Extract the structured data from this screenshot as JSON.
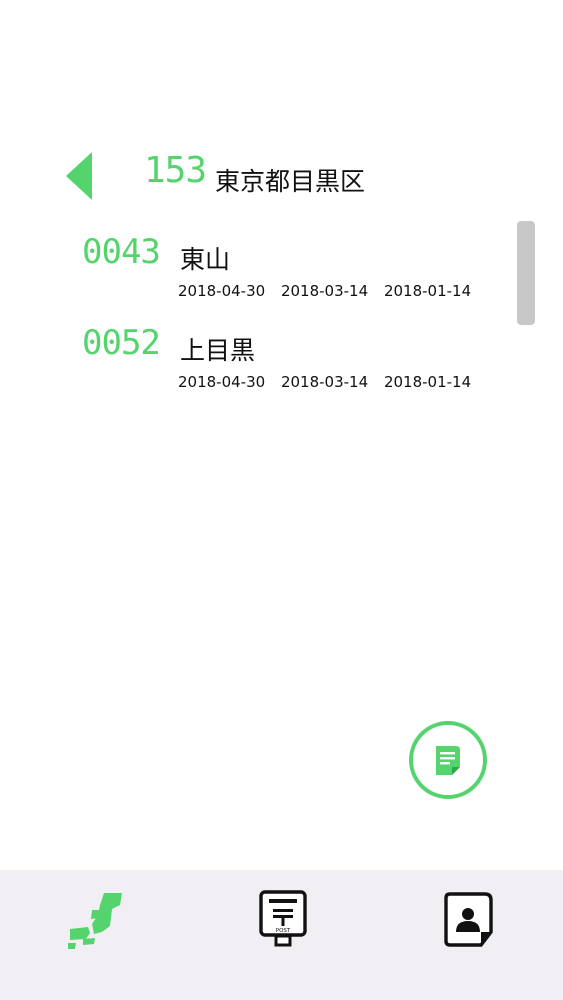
{
  "header": {
    "postal_prefix": "153",
    "area_name": "東京都目黒区"
  },
  "rows": [
    {
      "code": "0043",
      "name": "東山",
      "dates": [
        "2018-04-30",
        "2018-03-14",
        "2018-01-14"
      ]
    },
    {
      "code": "0052",
      "name": "上目黒",
      "dates": [
        "2018-04-30",
        "2018-03-14",
        "2018-01-14"
      ]
    }
  ],
  "fab": {
    "icon": "document-icon"
  },
  "tabbar": {
    "tabs": [
      {
        "icon": "japan-map-icon",
        "active": true
      },
      {
        "icon": "post-box-icon",
        "active": false
      },
      {
        "icon": "contact-card-icon",
        "active": false
      }
    ]
  },
  "colors": {
    "accent": "#55d46e",
    "text": "#111111",
    "tabbar_bg": "#f1eff3"
  }
}
